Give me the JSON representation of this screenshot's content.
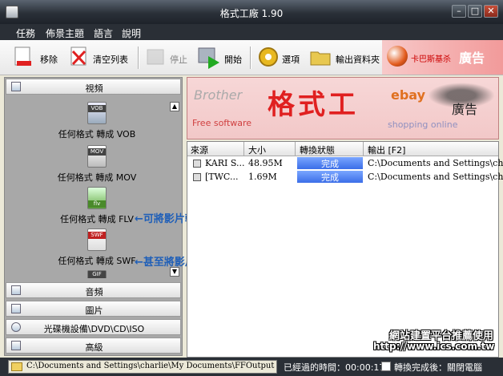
{
  "window": {
    "title": "格式工廠 1.90"
  },
  "menu": [
    "任務",
    "佈景主題",
    "語言",
    "說明"
  ],
  "toolbar": {
    "remove": "移除",
    "clear": "清空列表",
    "stop": "停止",
    "start": "開始",
    "options": "選項",
    "output_folder": "輸出資料夾"
  },
  "ad_top": {
    "small": "卡巴斯基杀",
    "big": "廣告"
  },
  "sidebar": {
    "video": "視頻",
    "audio": "音頻",
    "image": "圖片",
    "disc": "光碟機設備\\DVD\\CD\\ISO",
    "advanced": "高級",
    "formats": [
      {
        "tag": "VOB",
        "label": "任何格式 轉成 VOB"
      },
      {
        "tag": "MOV",
        "label": "任何格式 轉成 MOV"
      },
      {
        "tag": "flv",
        "label": "任何格式 轉成 FLV"
      },
      {
        "tag": "SWF",
        "label": "任何格式 轉成 SWF"
      },
      {
        "tag": "GIF",
        "label": ""
      }
    ]
  },
  "notes": {
    "flv": "←可將影片轉為網路播放格式，讚！",
    "swf": "←甚至將影片轉為Flash動畫。"
  },
  "banner": {
    "brother": "Brother",
    "main": "格式工",
    "free": "Free software",
    "ebay": "ebay",
    "shopping": "shopping online",
    "ad": "廣告"
  },
  "list": {
    "columns": [
      "來源",
      "大小",
      "轉換狀態",
      "輸出 [F2]"
    ],
    "rows": [
      {
        "source": "KARI S...",
        "size": "48.95M",
        "status": "完成",
        "output": "C:\\Documents and Settings\\cha..."
      },
      {
        "source": "[TWC...",
        "size": "1.69M",
        "status": "完成",
        "output": "C:\\Documents and Settings\\cha..."
      }
    ]
  },
  "watermark": {
    "line1": "網站建置平台推薦使用",
    "line2": "http://www.ics.com.tw"
  },
  "statusbar": {
    "path": "C:\\Documents and Settings\\charlie\\My Documents\\FFOutput",
    "elapsed": "已經過的時間：00:00:17",
    "after_done": "轉換完成後：關閉電腦"
  }
}
